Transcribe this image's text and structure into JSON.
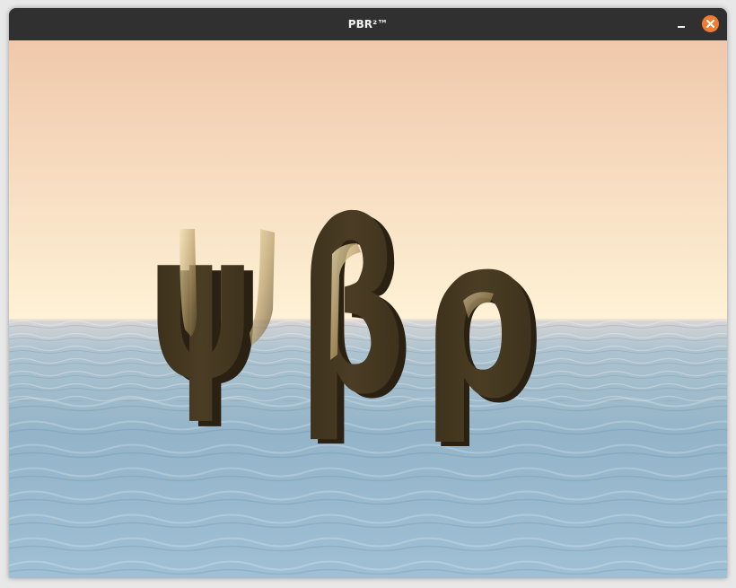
{
  "window": {
    "title": "PBR²™"
  },
  "scene": {
    "glyphs": [
      "ψ",
      "β",
      "ρ"
    ],
    "sky_top_color": "#f0c8aa",
    "sky_horizon_color": "#fdf0d2",
    "sea_color": "#8fb3c8",
    "metal_color": "#4a3c22",
    "highlight_color": "#e7d7a8"
  },
  "titlebar_buttons": {
    "minimize_icon": "minimize-icon",
    "close_icon": "close-icon",
    "close_color": "#f07c33"
  }
}
